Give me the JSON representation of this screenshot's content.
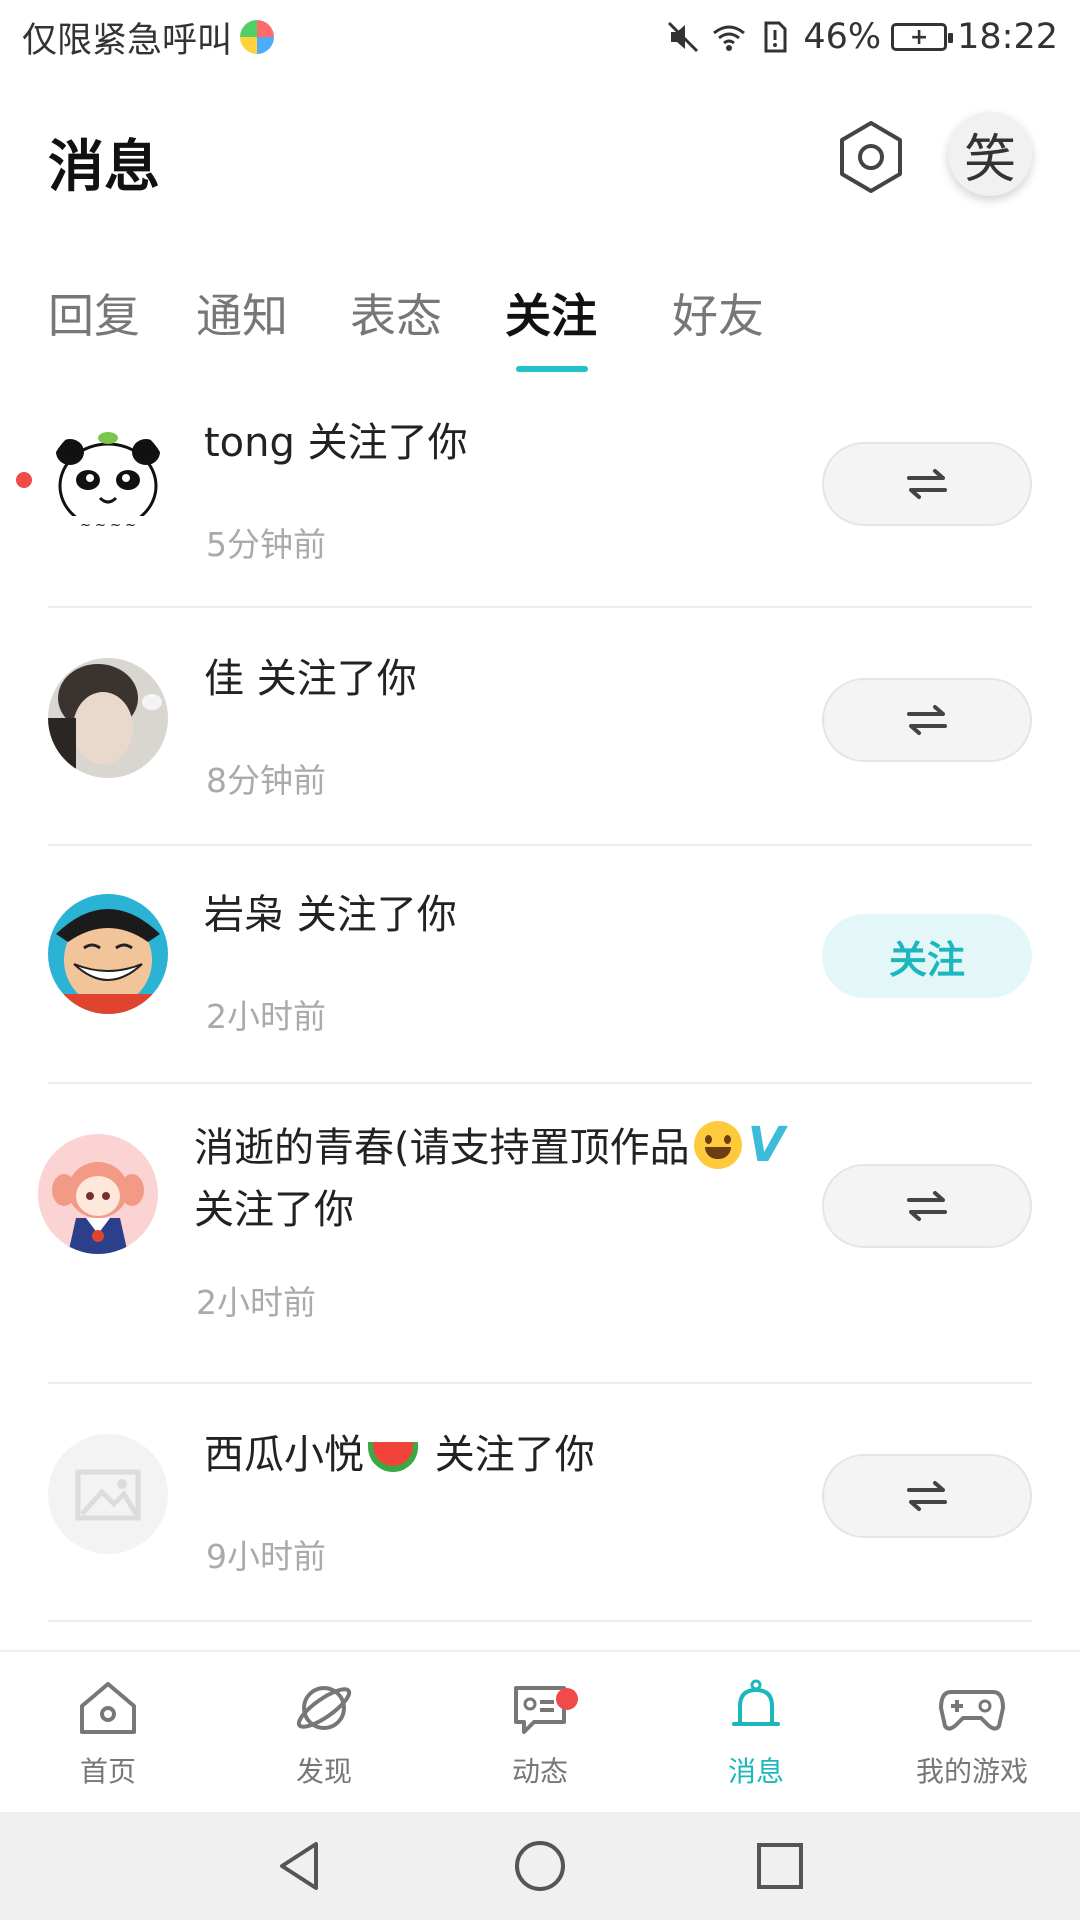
{
  "status_bar": {
    "carrier": "仅限紧急呼叫",
    "battery": "46%",
    "time": "18:22"
  },
  "header": {
    "title": "消息"
  },
  "avatar_me_char": "笑",
  "tabs": [
    {
      "label": "回复",
      "active": false
    },
    {
      "label": "通知",
      "active": false
    },
    {
      "label": "表态",
      "active": false
    },
    {
      "label": "关注",
      "active": true
    },
    {
      "label": "好友",
      "active": false
    }
  ],
  "items": [
    {
      "name": "tong",
      "action": "关注了你",
      "time": "5分钟前",
      "button": "mutual",
      "unread": true
    },
    {
      "name": "佳",
      "action": "关注了你",
      "time": "8分钟前",
      "button": "mutual",
      "unread": false
    },
    {
      "name": "岩枭",
      "action": "关注了你",
      "time": "2小时前",
      "button": "follow",
      "button_label": "关注",
      "unread": false
    },
    {
      "name": "消逝的青春(请支持置顶作品",
      "verified_mark": "V",
      "action": "关注了你",
      "time": "2小时前",
      "button": "mutual",
      "unread": false
    },
    {
      "name": "西瓜小悦",
      "action": "关注了你",
      "time": "9小时前",
      "button": "mutual",
      "unread": false
    }
  ],
  "bottom_nav": [
    {
      "label": "首页",
      "icon": "home-icon",
      "active": false
    },
    {
      "label": "发现",
      "icon": "planet-icon",
      "active": false
    },
    {
      "label": "动态",
      "icon": "feed-icon",
      "active": false,
      "badge": true
    },
    {
      "label": "消息",
      "icon": "bell-icon",
      "active": true
    },
    {
      "label": "我的游戏",
      "icon": "gamepad-icon",
      "active": false
    }
  ],
  "colors": {
    "accent": "#1cb6bd",
    "badge": "#f04a4a"
  }
}
